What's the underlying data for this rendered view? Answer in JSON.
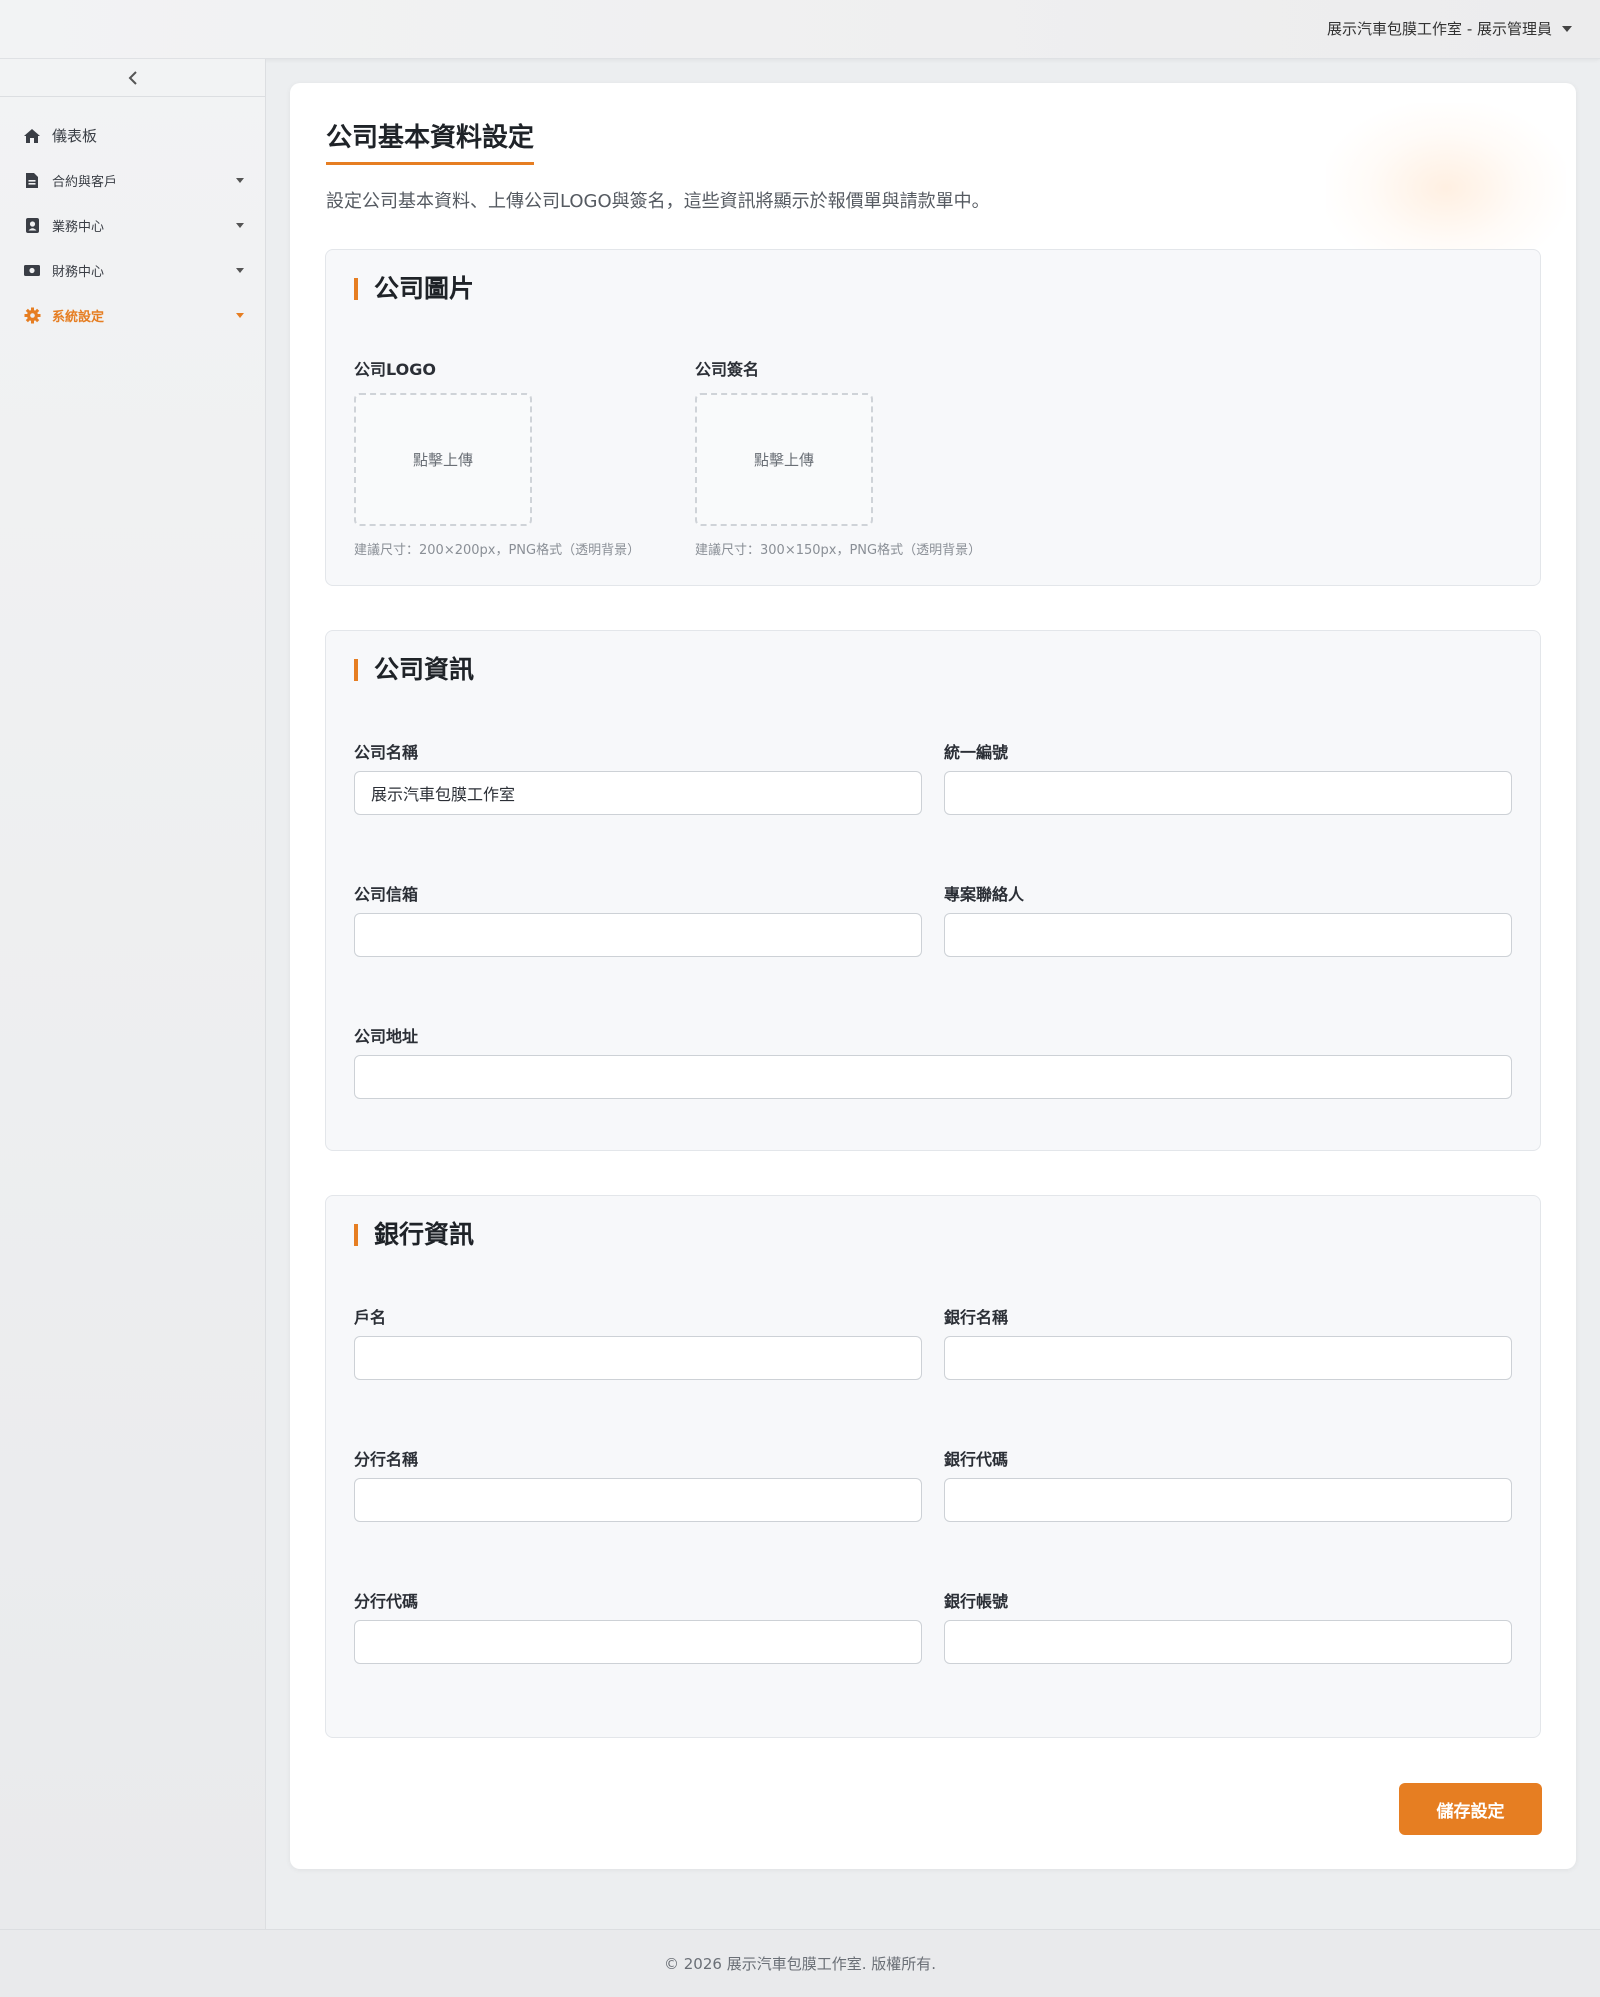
{
  "header": {
    "user_menu": "展示汽車包膜工作室 - 展示管理員"
  },
  "sidebar": {
    "items": [
      {
        "label": "儀表板",
        "icon": "home-icon"
      },
      {
        "label": "合約與客戶",
        "icon": "document-icon"
      },
      {
        "label": "業務中心",
        "icon": "contact-card-icon"
      },
      {
        "label": "財務中心",
        "icon": "money-icon"
      },
      {
        "label": "系統設定",
        "icon": "gear-icon",
        "active": true
      }
    ]
  },
  "page": {
    "title": "公司基本資料設定",
    "description": "設定公司基本資料、上傳公司LOGO與簽名，這些資訊將顯示於報價單與請款單中。"
  },
  "images_section": {
    "title": "公司圖片",
    "logo_label": "公司LOGO",
    "logo_upload": "點擊上傳",
    "logo_hint": "建議尺寸：200×200px，PNG格式（透明背景）",
    "signature_label": "公司簽名",
    "signature_upload": "點擊上傳",
    "signature_hint": "建議尺寸：300×150px，PNG格式（透明背景）"
  },
  "company_section": {
    "title": "公司資訊",
    "name_label": "公司名稱",
    "name_value": "展示汽車包膜工作室",
    "tax_id_label": "統一編號",
    "tax_id_value": "",
    "email_label": "公司信箱",
    "email_value": "",
    "contact_label": "專案聯絡人",
    "contact_value": "",
    "address_label": "公司地址",
    "address_value": ""
  },
  "bank_section": {
    "title": "銀行資訊",
    "account_name_label": "戶名",
    "account_name_value": "",
    "bank_name_label": "銀行名稱",
    "bank_name_value": "",
    "branch_name_label": "分行名稱",
    "branch_name_value": "",
    "bank_code_label": "銀行代碼",
    "bank_code_value": "",
    "branch_code_label": "分行代碼",
    "branch_code_value": "",
    "account_number_label": "銀行帳號",
    "account_number_value": ""
  },
  "actions": {
    "save_label": "儲存設定"
  },
  "footer": {
    "copyright": "© 2026 展示汽車包膜工作室. 版權所有."
  },
  "colors": {
    "accent": "#e67e22"
  }
}
